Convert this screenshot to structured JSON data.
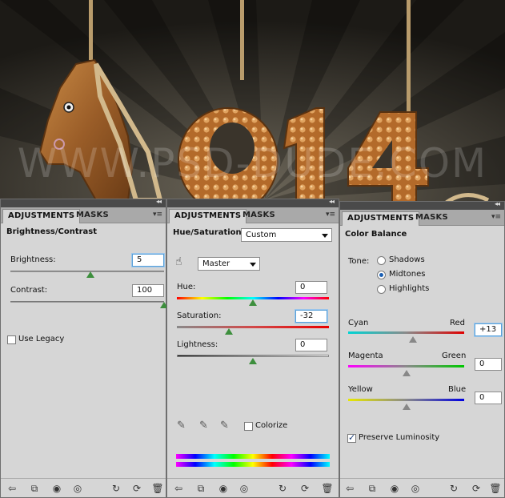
{
  "artwork": {
    "watermark": "WWW.PSD-DUDE.COM",
    "numerals": [
      "0",
      "1",
      "4"
    ]
  },
  "panels": [
    {
      "tabs": [
        "ADJUSTMENTS",
        "MASKS"
      ],
      "title": "Brightness/Contrast",
      "brightness": {
        "label": "Brightness:",
        "value": "5",
        "position": 0.52
      },
      "contrast": {
        "label": "Contrast:",
        "value": "100",
        "position": 1.0
      },
      "use_legacy": "Use Legacy",
      "use_legacy_checked": false
    },
    {
      "tabs": [
        "ADJUSTMENTS",
        "MASKS"
      ],
      "title": "Hue/Saturation",
      "preset": "Custom",
      "channel": "Master",
      "hue": {
        "label": "Hue:",
        "value": "0",
        "position": 0.5
      },
      "saturation": {
        "label": "Saturation:",
        "value": "-32",
        "position": 0.34
      },
      "lightness": {
        "label": "Lightness:",
        "value": "0",
        "position": 0.5
      },
      "colorize": "Colorize",
      "colorize_checked": false
    },
    {
      "tabs": [
        "ADJUSTMENTS",
        "MASKS"
      ],
      "title": "Color Balance",
      "tone_label": "Tone:",
      "tones": [
        "Shadows",
        "Midtones",
        "Highlights"
      ],
      "selected_tone": "Midtones",
      "cyan_red": {
        "left": "Cyan",
        "right": "Red",
        "value": "+13",
        "position": 0.56
      },
      "magenta_green": {
        "left": "Magenta",
        "right": "Green",
        "value": "0",
        "position": 0.5
      },
      "yellow_blue": {
        "left": "Yellow",
        "right": "Blue",
        "value": "0",
        "position": 0.5
      },
      "preserve_luminosity": "Preserve Luminosity",
      "preserve_checked": true
    }
  ],
  "colors": {
    "panel_bg": "#d6d6d6",
    "tab_bar": "#a9a9a9",
    "thumb": "#3d8f3d",
    "focus": "#5aa0d8"
  },
  "icons": [
    "back-arrow-icon",
    "clip-layer-icon",
    "mask-circle-icon",
    "eye-icon",
    "view-previous-icon",
    "reset-icon",
    "trash-icon"
  ]
}
